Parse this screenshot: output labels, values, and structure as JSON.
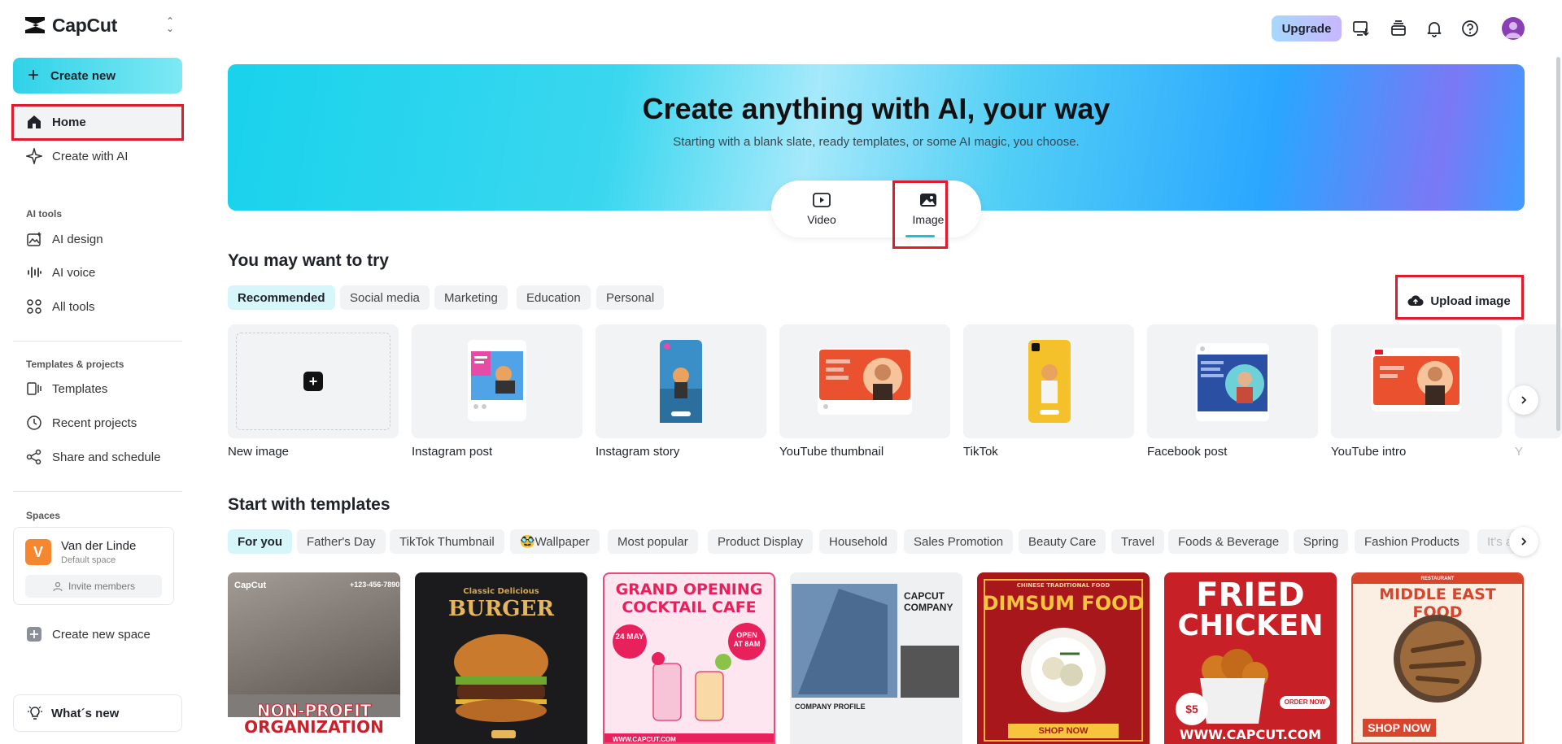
{
  "app": {
    "name": "CapCut"
  },
  "sidebar": {
    "create_label": "Create new",
    "nav": [
      {
        "label": "Home",
        "icon": "home-icon"
      },
      {
        "label": "Create with AI",
        "icon": "sparkle-icon"
      }
    ],
    "ai_tools_label": "AI tools",
    "ai_tools": [
      {
        "label": "AI design",
        "icon": "ai-design-icon"
      },
      {
        "label": "AI voice",
        "icon": "voice-icon"
      },
      {
        "label": "All tools",
        "icon": "grid-icon"
      }
    ],
    "templates_label": "Templates & projects",
    "templates_items": [
      {
        "label": "Templates",
        "icon": "templates-icon"
      },
      {
        "label": "Recent projects",
        "icon": "clock-icon"
      },
      {
        "label": "Share and schedule",
        "icon": "share-icon"
      }
    ],
    "spaces_label": "Spaces",
    "space": {
      "initial": "V",
      "name": "Van der Linde",
      "sub": "Default space",
      "invite": "Invite members"
    },
    "create_space": "Create new space",
    "whats_new": "What´s new"
  },
  "topbar": {
    "upgrade": "Upgrade"
  },
  "hero": {
    "title": "Create anything with AI, your way",
    "subtitle": "Starting with a blank slate, ready templates, or some AI magic, you choose.",
    "modes": [
      {
        "label": "Video"
      },
      {
        "label": "Image"
      }
    ]
  },
  "try_section": {
    "title": "You may want to try",
    "chips": [
      "Recommended",
      "Social media",
      "Marketing",
      "Education",
      "Personal"
    ],
    "upload": "Upload image",
    "cards": [
      "New image",
      "Instagram post",
      "Instagram story",
      "YouTube thumbnail",
      "TikTok",
      "Facebook post",
      "YouTube intro",
      "Y"
    ]
  },
  "templates_section": {
    "title": "Start with templates",
    "chips": [
      "For you",
      "Father's Day",
      "TikTok Thumbnail",
      "🥸Wallpaper",
      "Most popular",
      "Product Display",
      "Household",
      "Sales Promotion",
      "Beauty Care",
      "Travel",
      "Foods & Beverage",
      "Spring",
      "Fashion Products",
      "It's a"
    ],
    "thumbs": [
      {
        "line1": "NON-PROFIT",
        "line2": "ORGANIZATION",
        "top": "+123-456-7890"
      },
      {
        "line1": "Classic Delicious",
        "line2": "BURGER"
      },
      {
        "line1": "GRAND OPENING",
        "line2": "COCKTAIL CAFE",
        "badge1": "24 MAY",
        "badge2": "OPEN AT 8AM",
        "footer": "WWW.CAPCUT.COM"
      },
      {
        "line1": "CAPCUT",
        "line2": "COMPANY",
        "footer": "COMPANY PROFILE"
      },
      {
        "line1": "CHINESE TRADITIONAL FOOD",
        "line2": "DIMSUM FOOD",
        "footer": "SHOP NOW"
      },
      {
        "line1": "FRIED",
        "line2": "CHICKEN",
        "badge1": "$5",
        "footer": "WWW.CAPCUT.COM",
        "badge2": "ORDER NOW"
      },
      {
        "line1": "MIDDLE EAST FOOD",
        "footer": "SHOP NOW",
        "top": "RESTAURANT"
      }
    ]
  }
}
